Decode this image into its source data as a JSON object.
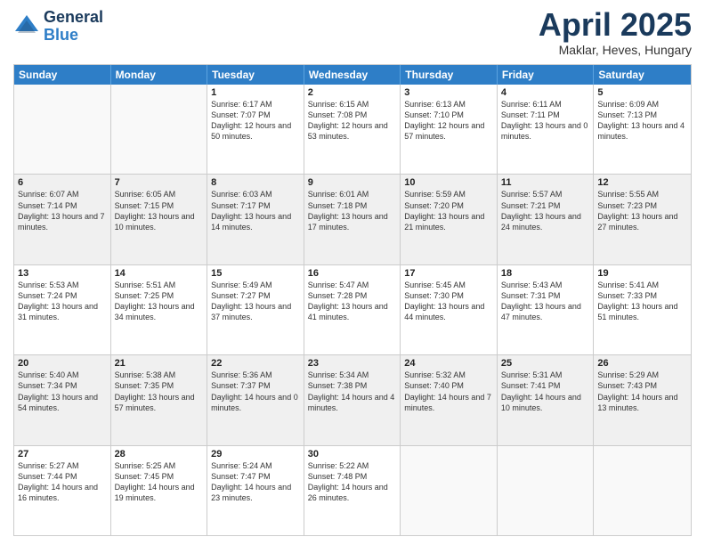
{
  "header": {
    "logo_line1": "General",
    "logo_line2": "Blue",
    "month": "April 2025",
    "location": "Maklar, Heves, Hungary"
  },
  "days_of_week": [
    "Sunday",
    "Monday",
    "Tuesday",
    "Wednesday",
    "Thursday",
    "Friday",
    "Saturday"
  ],
  "weeks": [
    [
      {
        "day": "",
        "sunrise": "",
        "sunset": "",
        "daylight": "",
        "empty": true
      },
      {
        "day": "",
        "sunrise": "",
        "sunset": "",
        "daylight": "",
        "empty": true
      },
      {
        "day": "1",
        "sunrise": "Sunrise: 6:17 AM",
        "sunset": "Sunset: 7:07 PM",
        "daylight": "Daylight: 12 hours and 50 minutes.",
        "empty": false
      },
      {
        "day": "2",
        "sunrise": "Sunrise: 6:15 AM",
        "sunset": "Sunset: 7:08 PM",
        "daylight": "Daylight: 12 hours and 53 minutes.",
        "empty": false
      },
      {
        "day": "3",
        "sunrise": "Sunrise: 6:13 AM",
        "sunset": "Sunset: 7:10 PM",
        "daylight": "Daylight: 12 hours and 57 minutes.",
        "empty": false
      },
      {
        "day": "4",
        "sunrise": "Sunrise: 6:11 AM",
        "sunset": "Sunset: 7:11 PM",
        "daylight": "Daylight: 13 hours and 0 minutes.",
        "empty": false
      },
      {
        "day": "5",
        "sunrise": "Sunrise: 6:09 AM",
        "sunset": "Sunset: 7:13 PM",
        "daylight": "Daylight: 13 hours and 4 minutes.",
        "empty": false
      }
    ],
    [
      {
        "day": "6",
        "sunrise": "Sunrise: 6:07 AM",
        "sunset": "Sunset: 7:14 PM",
        "daylight": "Daylight: 13 hours and 7 minutes.",
        "empty": false
      },
      {
        "day": "7",
        "sunrise": "Sunrise: 6:05 AM",
        "sunset": "Sunset: 7:15 PM",
        "daylight": "Daylight: 13 hours and 10 minutes.",
        "empty": false
      },
      {
        "day": "8",
        "sunrise": "Sunrise: 6:03 AM",
        "sunset": "Sunset: 7:17 PM",
        "daylight": "Daylight: 13 hours and 14 minutes.",
        "empty": false
      },
      {
        "day": "9",
        "sunrise": "Sunrise: 6:01 AM",
        "sunset": "Sunset: 7:18 PM",
        "daylight": "Daylight: 13 hours and 17 minutes.",
        "empty": false
      },
      {
        "day": "10",
        "sunrise": "Sunrise: 5:59 AM",
        "sunset": "Sunset: 7:20 PM",
        "daylight": "Daylight: 13 hours and 21 minutes.",
        "empty": false
      },
      {
        "day": "11",
        "sunrise": "Sunrise: 5:57 AM",
        "sunset": "Sunset: 7:21 PM",
        "daylight": "Daylight: 13 hours and 24 minutes.",
        "empty": false
      },
      {
        "day": "12",
        "sunrise": "Sunrise: 5:55 AM",
        "sunset": "Sunset: 7:23 PM",
        "daylight": "Daylight: 13 hours and 27 minutes.",
        "empty": false
      }
    ],
    [
      {
        "day": "13",
        "sunrise": "Sunrise: 5:53 AM",
        "sunset": "Sunset: 7:24 PM",
        "daylight": "Daylight: 13 hours and 31 minutes.",
        "empty": false
      },
      {
        "day": "14",
        "sunrise": "Sunrise: 5:51 AM",
        "sunset": "Sunset: 7:25 PM",
        "daylight": "Daylight: 13 hours and 34 minutes.",
        "empty": false
      },
      {
        "day": "15",
        "sunrise": "Sunrise: 5:49 AM",
        "sunset": "Sunset: 7:27 PM",
        "daylight": "Daylight: 13 hours and 37 minutes.",
        "empty": false
      },
      {
        "day": "16",
        "sunrise": "Sunrise: 5:47 AM",
        "sunset": "Sunset: 7:28 PM",
        "daylight": "Daylight: 13 hours and 41 minutes.",
        "empty": false
      },
      {
        "day": "17",
        "sunrise": "Sunrise: 5:45 AM",
        "sunset": "Sunset: 7:30 PM",
        "daylight": "Daylight: 13 hours and 44 minutes.",
        "empty": false
      },
      {
        "day": "18",
        "sunrise": "Sunrise: 5:43 AM",
        "sunset": "Sunset: 7:31 PM",
        "daylight": "Daylight: 13 hours and 47 minutes.",
        "empty": false
      },
      {
        "day": "19",
        "sunrise": "Sunrise: 5:41 AM",
        "sunset": "Sunset: 7:33 PM",
        "daylight": "Daylight: 13 hours and 51 minutes.",
        "empty": false
      }
    ],
    [
      {
        "day": "20",
        "sunrise": "Sunrise: 5:40 AM",
        "sunset": "Sunset: 7:34 PM",
        "daylight": "Daylight: 13 hours and 54 minutes.",
        "empty": false
      },
      {
        "day": "21",
        "sunrise": "Sunrise: 5:38 AM",
        "sunset": "Sunset: 7:35 PM",
        "daylight": "Daylight: 13 hours and 57 minutes.",
        "empty": false
      },
      {
        "day": "22",
        "sunrise": "Sunrise: 5:36 AM",
        "sunset": "Sunset: 7:37 PM",
        "daylight": "Daylight: 14 hours and 0 minutes.",
        "empty": false
      },
      {
        "day": "23",
        "sunrise": "Sunrise: 5:34 AM",
        "sunset": "Sunset: 7:38 PM",
        "daylight": "Daylight: 14 hours and 4 minutes.",
        "empty": false
      },
      {
        "day": "24",
        "sunrise": "Sunrise: 5:32 AM",
        "sunset": "Sunset: 7:40 PM",
        "daylight": "Daylight: 14 hours and 7 minutes.",
        "empty": false
      },
      {
        "day": "25",
        "sunrise": "Sunrise: 5:31 AM",
        "sunset": "Sunset: 7:41 PM",
        "daylight": "Daylight: 14 hours and 10 minutes.",
        "empty": false
      },
      {
        "day": "26",
        "sunrise": "Sunrise: 5:29 AM",
        "sunset": "Sunset: 7:43 PM",
        "daylight": "Daylight: 14 hours and 13 minutes.",
        "empty": false
      }
    ],
    [
      {
        "day": "27",
        "sunrise": "Sunrise: 5:27 AM",
        "sunset": "Sunset: 7:44 PM",
        "daylight": "Daylight: 14 hours and 16 minutes.",
        "empty": false
      },
      {
        "day": "28",
        "sunrise": "Sunrise: 5:25 AM",
        "sunset": "Sunset: 7:45 PM",
        "daylight": "Daylight: 14 hours and 19 minutes.",
        "empty": false
      },
      {
        "day": "29",
        "sunrise": "Sunrise: 5:24 AM",
        "sunset": "Sunset: 7:47 PM",
        "daylight": "Daylight: 14 hours and 23 minutes.",
        "empty": false
      },
      {
        "day": "30",
        "sunrise": "Sunrise: 5:22 AM",
        "sunset": "Sunset: 7:48 PM",
        "daylight": "Daylight: 14 hours and 26 minutes.",
        "empty": false
      },
      {
        "day": "",
        "sunrise": "",
        "sunset": "",
        "daylight": "",
        "empty": true
      },
      {
        "day": "",
        "sunrise": "",
        "sunset": "",
        "daylight": "",
        "empty": true
      },
      {
        "day": "",
        "sunrise": "",
        "sunset": "",
        "daylight": "",
        "empty": true
      }
    ]
  ]
}
